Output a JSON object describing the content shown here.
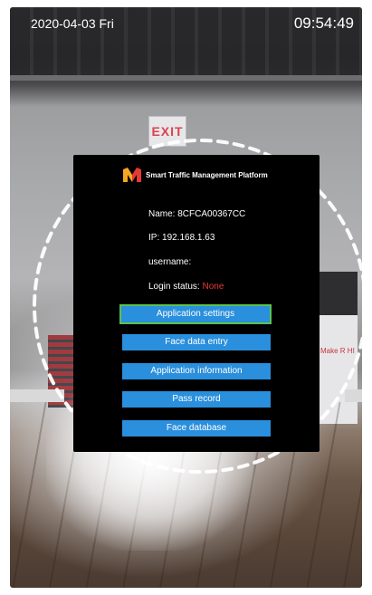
{
  "status_bar": {
    "date": "2020-04-03 Fri",
    "time": "09:54:49"
  },
  "camera_scene": {
    "exit_sign_text": "EXIT",
    "stand_text": "Make R HI"
  },
  "dialog": {
    "brand_icon": "logo-m-icon",
    "title": "Smart Traffic Management Platform",
    "name_line": "Name: 8CFCA00367CC",
    "ip_line": "IP: 192.168.1.63",
    "username_line": "username:",
    "login_status_label": "Login status: ",
    "login_status_value": "None",
    "buttons": [
      {
        "label": "Application settings",
        "focused": true
      },
      {
        "label": "Face data entry",
        "focused": false
      },
      {
        "label": "Application information",
        "focused": false
      },
      {
        "label": "Pass record",
        "focused": false
      },
      {
        "label": "Face database",
        "focused": false
      }
    ]
  },
  "colors": {
    "dialog_bg": "#000000",
    "button_bg": "#2a8fdc",
    "focus_border": "#5cc14d",
    "status_none": "#e53935",
    "brand_orange": "#f5a623",
    "brand_red": "#e53935"
  }
}
